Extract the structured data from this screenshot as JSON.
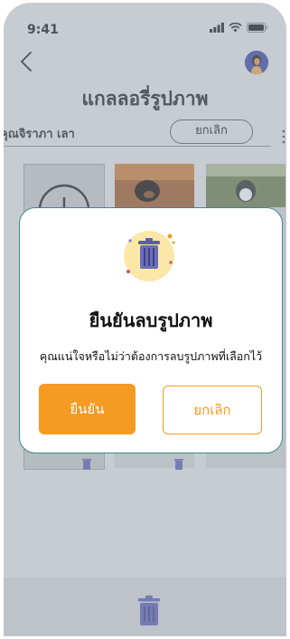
{
  "status_bar": {
    "time": "9:41"
  },
  "header": {
    "title": "แกลลอรี่รูปภาพ"
  },
  "user_row": {
    "name": "คุณจิราภา เลา",
    "cancel_label": "ยกเลิก"
  },
  "dialog": {
    "title": "ยืนยันลบรูปภาพ",
    "message": "คุณแน่ใจหรือไม่ว่าต้องการลบรูปภาพที่เลือกไว้",
    "confirm_label": "ยืนยัน",
    "cancel_label": "ยกเลิก"
  },
  "colors": {
    "accent": "#f59a23",
    "dialog_border": "#3f8a86",
    "trash_purple": "#5a5ea8",
    "icon_circle": "#fbe7a8"
  },
  "icons": {
    "back": "chevron-left-icon",
    "avatar": "avatar",
    "menu": "kebab-icon",
    "add": "add-icon",
    "trash": "trash-icon"
  }
}
